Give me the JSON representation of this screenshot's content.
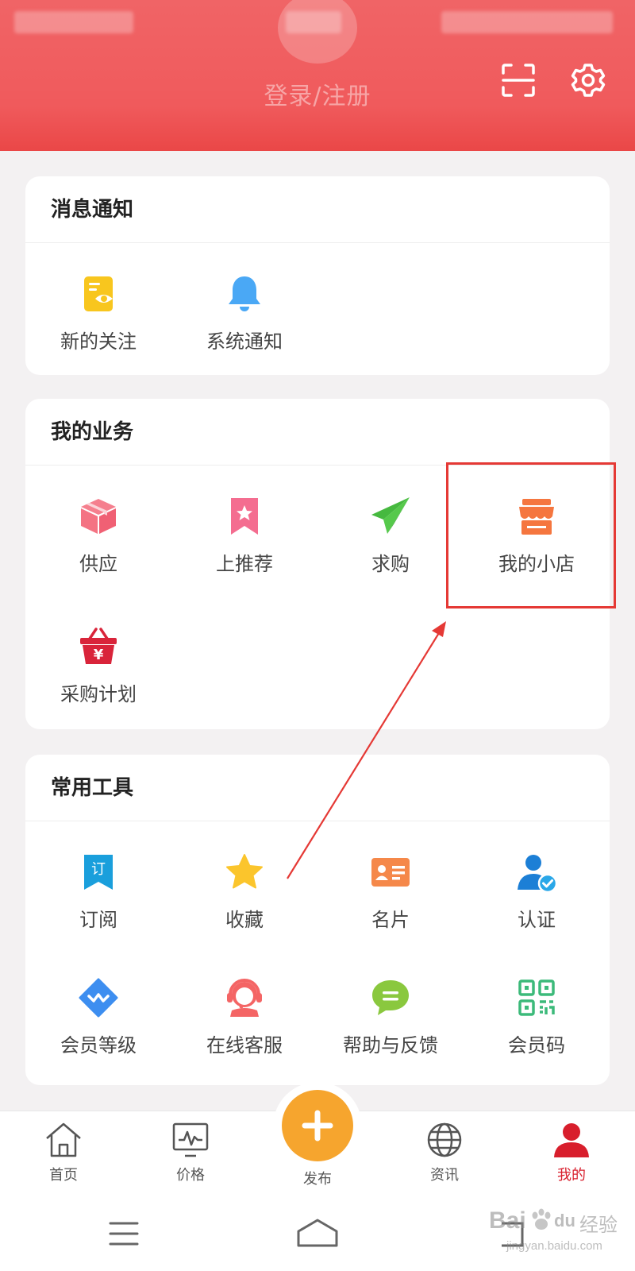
{
  "header": {
    "login_label": "登录/注册",
    "bg_color": "#f05a5c"
  },
  "notifications": {
    "title": "消息通知",
    "items": [
      {
        "label": "新的关注",
        "icon": "eye-document-icon"
      },
      {
        "label": "系统通知",
        "icon": "bell-icon"
      }
    ]
  },
  "business": {
    "title": "我的业务",
    "items": [
      {
        "label": "供应",
        "icon": "box-icon"
      },
      {
        "label": "上推荐",
        "icon": "bookmark-star-icon"
      },
      {
        "label": "求购",
        "icon": "paper-plane-icon"
      },
      {
        "label": "我的小店",
        "icon": "shop-icon"
      },
      {
        "label": "采购计划",
        "icon": "basket-yen-icon"
      }
    ]
  },
  "tools": {
    "title": "常用工具",
    "items": [
      {
        "label": "订阅",
        "icon": "subscribe-bookmark-icon",
        "glyph": "订"
      },
      {
        "label": "收藏",
        "icon": "star-icon"
      },
      {
        "label": "名片",
        "icon": "business-card-icon"
      },
      {
        "label": "认证",
        "icon": "verified-user-icon"
      },
      {
        "label": "会员等级",
        "icon": "diamond-icon"
      },
      {
        "label": "在线客服",
        "icon": "headset-icon"
      },
      {
        "label": "帮助与反馈",
        "icon": "chat-bubble-icon"
      },
      {
        "label": "会员码",
        "icon": "qr-code-icon"
      }
    ]
  },
  "bottom_nav": {
    "items": [
      {
        "label": "首页",
        "icon": "home-icon"
      },
      {
        "label": "价格",
        "icon": "price-chart-icon"
      },
      {
        "label": "发布",
        "icon": "plus-icon"
      },
      {
        "label": "资讯",
        "icon": "globe-icon"
      },
      {
        "label": "我的",
        "icon": "user-icon",
        "active": true
      }
    ]
  },
  "watermark": {
    "brand": "Bai",
    "brand2": "du",
    "cn": "经验",
    "url": "jingyan.baidu.com"
  },
  "colors": {
    "accent": "#d81e2c",
    "fab": "#f6a52e",
    "highlight": "#e53935"
  }
}
